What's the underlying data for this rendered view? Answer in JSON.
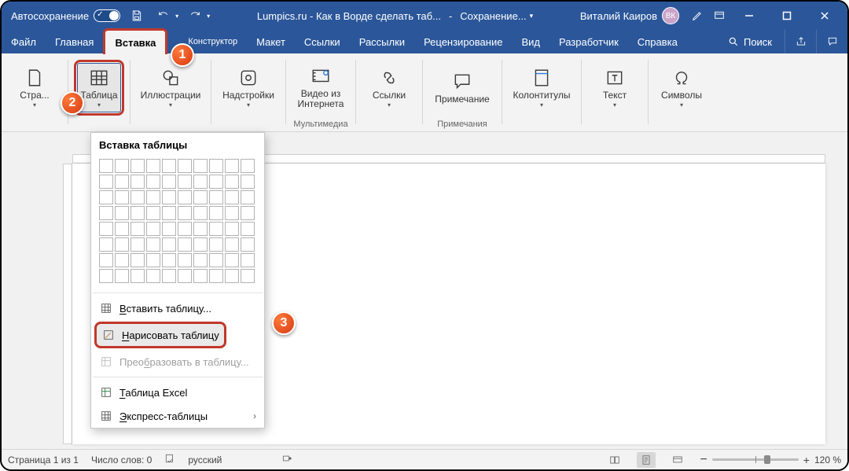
{
  "colors": {
    "accent": "#2b579a",
    "highlight": "#c0392b"
  },
  "titlebar": {
    "autosave": "Автосохранение",
    "document_title": "Lumpics.ru - Как в Ворде сделать таб...",
    "saving": "Сохранение...",
    "user_name": "Виталий Каиров",
    "user_initials": "ВК"
  },
  "tabs": {
    "items": [
      "Файл",
      "Главная",
      "Вставка",
      "Конструктор",
      "Макет",
      "Ссылки",
      "Рассылки",
      "Рецензирование",
      "Вид",
      "Разработчик",
      "Справка"
    ],
    "active_index": 2,
    "search": "Поиск"
  },
  "ribbon": {
    "pages": {
      "button": "Стра..."
    },
    "table": {
      "button": "Таблица"
    },
    "illustrations": {
      "button": "Иллюстрации"
    },
    "addins": {
      "button": "Надстройки"
    },
    "media": {
      "button_line1": "Видео из",
      "button_line2": "Интернета",
      "group": "Мультимедиа"
    },
    "links": {
      "button": "Ссылки"
    },
    "comments": {
      "button": "Примечание",
      "group": "Примечания"
    },
    "headerfooter": {
      "button": "Колонтитулы"
    },
    "text": {
      "button": "Текст"
    },
    "symbols": {
      "button": "Символы"
    }
  },
  "dropdown": {
    "title": "Вставка таблицы",
    "insert_table": "Вставить таблицу...",
    "draw_table": "Нарисовать таблицу",
    "convert": "Преобразовать в таблицу...",
    "excel": "Таблица Excel",
    "quick": "Экспресс-таблицы"
  },
  "callouts": {
    "one": "1",
    "two": "2",
    "three": "3"
  },
  "statusbar": {
    "page": "Страница 1 из 1",
    "words": "Число слов: 0",
    "language": "русский",
    "zoom": "120 %"
  }
}
